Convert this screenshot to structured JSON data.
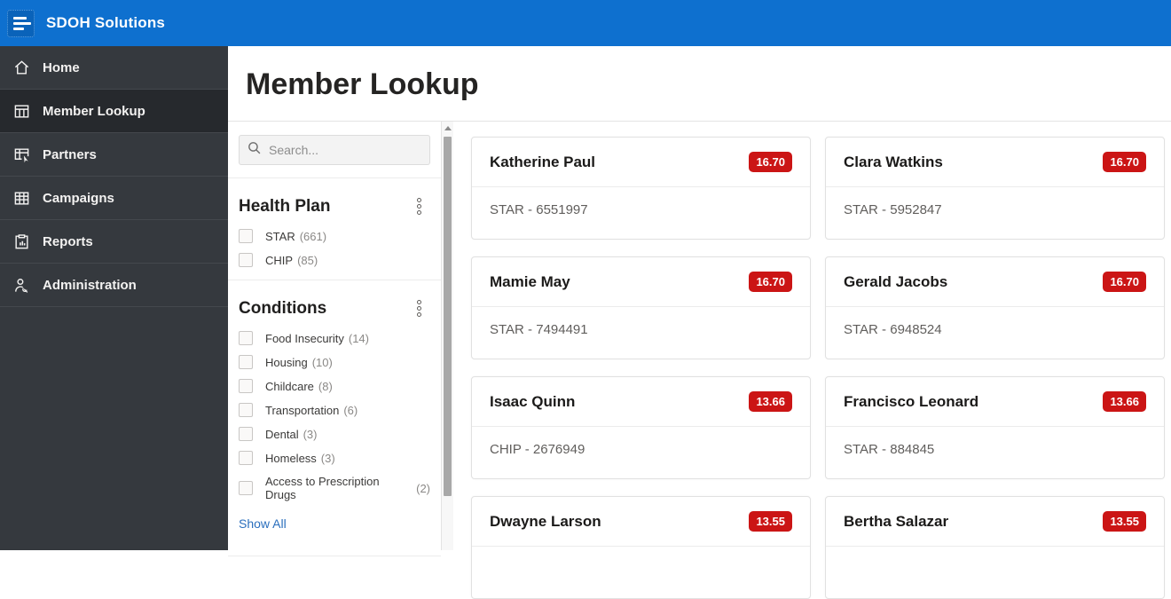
{
  "app": {
    "title": "SDOH Solutions"
  },
  "sidebar": {
    "items": [
      {
        "label": "Home",
        "icon": "home-icon",
        "active": false
      },
      {
        "label": "Member Lookup",
        "icon": "member-lookup-icon",
        "active": true
      },
      {
        "label": "Partners",
        "icon": "partners-icon",
        "active": false
      },
      {
        "label": "Campaigns",
        "icon": "campaigns-icon",
        "active": false
      },
      {
        "label": "Reports",
        "icon": "reports-icon",
        "active": false
      },
      {
        "label": "Administration",
        "icon": "administration-icon",
        "active": false
      }
    ]
  },
  "page": {
    "title": "Member Lookup"
  },
  "filters": {
    "search_placeholder": "Search...",
    "health_plan": {
      "title": "Health Plan",
      "options": [
        {
          "label": "STAR",
          "count": "(661)",
          "checked": false
        },
        {
          "label": "CHIP",
          "count": "(85)",
          "checked": false
        }
      ]
    },
    "conditions": {
      "title": "Conditions",
      "options": [
        {
          "label": "Food Insecurity",
          "count": "(14)",
          "checked": false
        },
        {
          "label": "Housing",
          "count": "(10)",
          "checked": false
        },
        {
          "label": "Childcare",
          "count": "(8)",
          "checked": false
        },
        {
          "label": "Transportation",
          "count": "(6)",
          "checked": false
        },
        {
          "label": "Dental",
          "count": "(3)",
          "checked": false
        },
        {
          "label": "Homeless",
          "count": "(3)",
          "checked": false
        },
        {
          "label": "Access to Prescription Drugs",
          "count": "(2)",
          "checked": false
        }
      ],
      "show_all_label": "Show All"
    }
  },
  "members": [
    {
      "name": "Katherine Paul",
      "score": "16.70",
      "plan": "STAR - 6551997"
    },
    {
      "name": "Clara Watkins",
      "score": "16.70",
      "plan": "STAR - 5952847"
    },
    {
      "name": "Mamie May",
      "score": "16.70",
      "plan": "STAR - 7494491"
    },
    {
      "name": "Gerald Jacobs",
      "score": "16.70",
      "plan": "STAR - 6948524"
    },
    {
      "name": "Isaac Quinn",
      "score": "13.66",
      "plan": "CHIP - 2676949"
    },
    {
      "name": "Francisco Leonard",
      "score": "13.66",
      "plan": "STAR - 884845"
    },
    {
      "name": "Dwayne Larson",
      "score": "13.55",
      "plan": ""
    },
    {
      "name": "Bertha Salazar",
      "score": "13.55",
      "plan": ""
    }
  ],
  "colors": {
    "topbar_blue": "#0e70cf",
    "sidebar_dark": "#35393e",
    "badge_red": "#cb1515",
    "link_blue": "#2b6fbd"
  }
}
